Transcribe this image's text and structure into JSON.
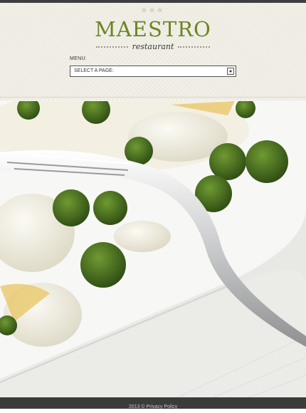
{
  "header": {
    "stars": "☆☆☆",
    "logo_title": "MAESTRO",
    "logo_subtitle": "restaurant",
    "accent_color": "#6d8424"
  },
  "menu": {
    "label": "MENU:",
    "select_value": "SELECT A PAGE:"
  },
  "hero": {
    "image": "pasta-broccoli-with-fork-photo"
  },
  "footer": {
    "text": "2013 © Privacy Policy"
  }
}
